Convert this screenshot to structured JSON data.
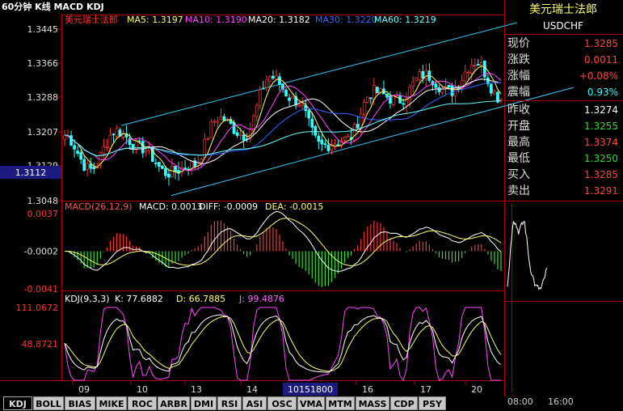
{
  "header": {
    "period_label": "60分钟 K线 MACD KDJ",
    "symbol_cn": "美元瑞士法郎",
    "ma": [
      {
        "label": "MA5: 1.3197",
        "color": "#ffff66"
      },
      {
        "label": "MA10: 1.3190",
        "color": "#ff44ff"
      },
      {
        "label": "MA20: 1.3182",
        "color": "#ffffff"
      },
      {
        "label": "MA30: 1.3220",
        "color": "#3366ff"
      },
      {
        "label": "MA60: 1.3219",
        "color": "#66ffff"
      }
    ]
  },
  "price_axis": [
    "1.3445",
    "1.3366",
    "1.3288",
    "1.3207",
    "1.3129",
    "1.3048"
  ],
  "price_axis_range": [
    1.3048,
    1.3445
  ],
  "cursor_price": "1.3112",
  "macd": {
    "title": "MACD(26,12,9)",
    "macd_label": "MACD: 0.0013",
    "diff_label": "DIFF: -0.0009",
    "dea_label": "DEA: -0.0015",
    "axis": [
      "0.0037",
      "-0.0002",
      "-0.0041"
    ],
    "axis_range": [
      -0.0041,
      0.0037
    ]
  },
  "kdj": {
    "title": "KDJ(9,3,3)",
    "k_label": "K: 77.6882",
    "d_label": "D: 66.7885",
    "j_label": "J: 99.4876",
    "axis": [
      "111.0672",
      "48.8721"
    ],
    "axis_range": [
      -13.3,
      111.0672
    ]
  },
  "x_axis": [
    "09",
    "10",
    "13",
    "14",
    "15",
    "16",
    "17",
    "20"
  ],
  "cursor_date": "10151800",
  "right_panel": {
    "name_cn": "美元瑞士法郎",
    "name_en": "USDCHF",
    "rows": [
      {
        "label": "现价",
        "value": "1.3285",
        "color": "#ff4444"
      },
      {
        "label": "涨跌",
        "value": "0.0011",
        "color": "#ff4444"
      },
      {
        "label": "涨幅",
        "value": "+0.08%",
        "color": "#ff4444"
      },
      {
        "label": "震幅",
        "value": "0.93%",
        "color": "#33ffff"
      },
      {
        "label": "昨收",
        "value": "1.3274",
        "color": "#ffffff"
      },
      {
        "label": "开盘",
        "value": "1.3255",
        "color": "#33dd33"
      },
      {
        "label": "最高",
        "value": "1.3374",
        "color": "#ff4444"
      },
      {
        "label": "最低",
        "value": "1.3250",
        "color": "#33dd33"
      },
      {
        "label": "买入",
        "value": "1.3285",
        "color": "#ff4444"
      },
      {
        "label": "卖出",
        "value": "1.3291",
        "color": "#ff4444"
      }
    ],
    "time_axis": [
      "08:00",
      "16:00"
    ]
  },
  "tabs": [
    "KDJ",
    "BOLL",
    "BIAS",
    "MIKE",
    "ROC",
    "ARBR",
    "DMI",
    "RSI",
    "ASI",
    "OSC",
    "VMA",
    "MTM",
    "MASS",
    "CDP",
    "PSY"
  ],
  "chart_data": {
    "type": "candlestick",
    "x": [
      "09",
      "10",
      "13",
      "14",
      "15",
      "16",
      "17",
      "20"
    ],
    "close": [
      1.3115,
      1.3195,
      1.3112,
      1.3335,
      1.3175,
      1.33,
      1.336,
      1.3285
    ],
    "ylim": [
      1.3048,
      1.3445
    ],
    "macd_ylim": [
      -0.0041,
      0.0037
    ],
    "kdj_ylim": [
      -13.3,
      111.0672
    ],
    "mini_intraday": [
      1.3255,
      1.3374,
      1.335,
      1.337,
      1.329,
      1.3255,
      1.325,
      1.3285
    ]
  }
}
